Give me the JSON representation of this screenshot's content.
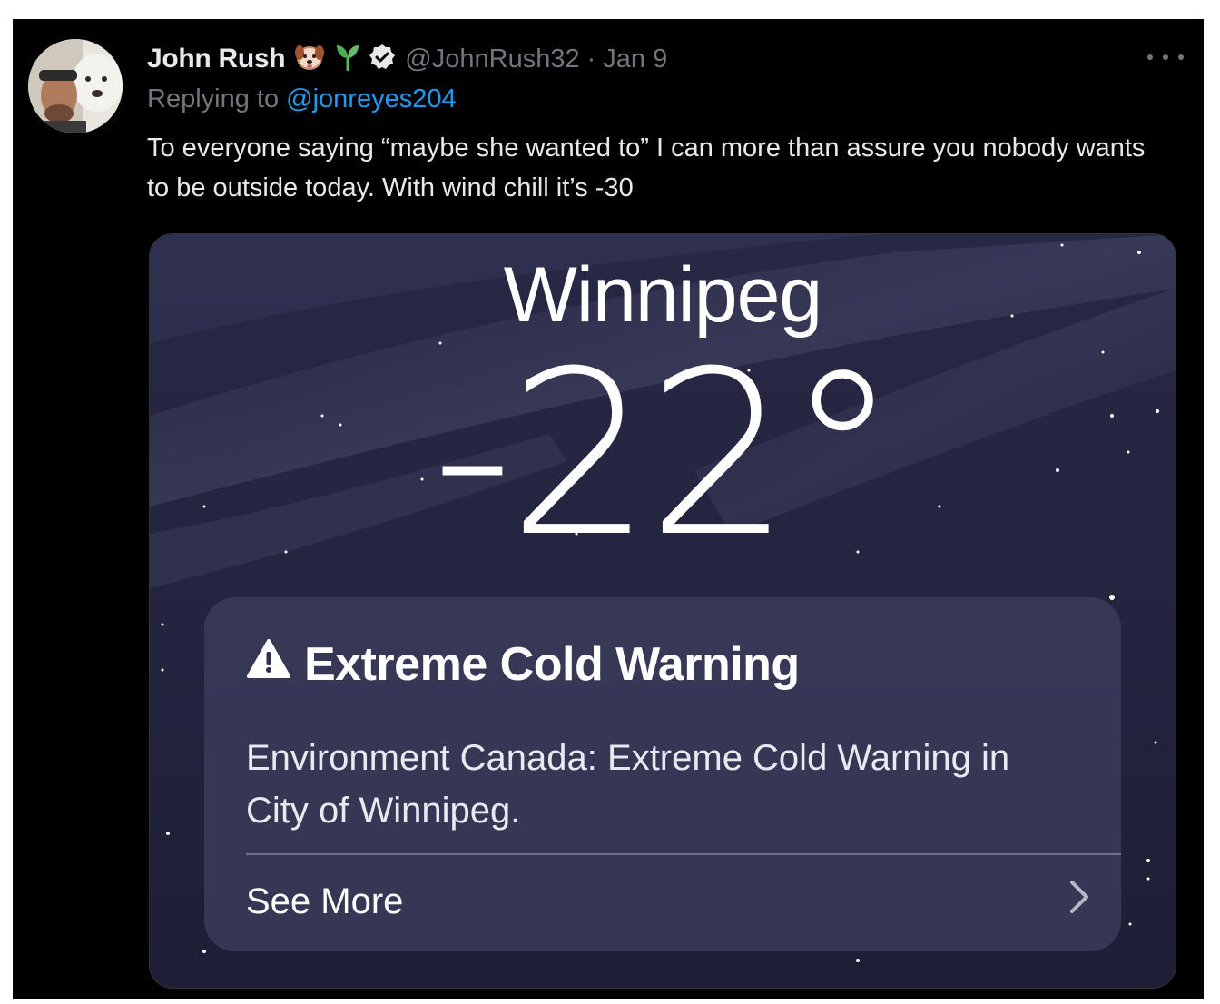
{
  "tweet": {
    "display_name": "John Rush",
    "handle": "@JohnRush32",
    "separator": "·",
    "date": "Jan 9",
    "replying_prefix": "Replying to",
    "replying_to": "@jonreyes204",
    "text": "To everyone saying “maybe she wanted to” I can more than assure you nobody wants to be outside today. With wind chill it’s -30",
    "emoji_icons": [
      "dog-face-icon",
      "seedling-icon"
    ],
    "verified_icon": "verified-badge-icon"
  },
  "media": {
    "city": "Winnipeg",
    "temperature": "-22°",
    "alert": {
      "icon": "warning-triangle-icon",
      "title": "Extreme Cold Warning",
      "body": "Environment Canada: Extreme Cold Warning in City of Winnipeg.",
      "see_more": "See More",
      "chevron": "chevron-right-icon"
    }
  },
  "colors": {
    "background": "#000000",
    "text_primary": "#e7e9ea",
    "text_secondary": "#71767b",
    "link": "#1d9bf0",
    "sky": "#24253f"
  }
}
